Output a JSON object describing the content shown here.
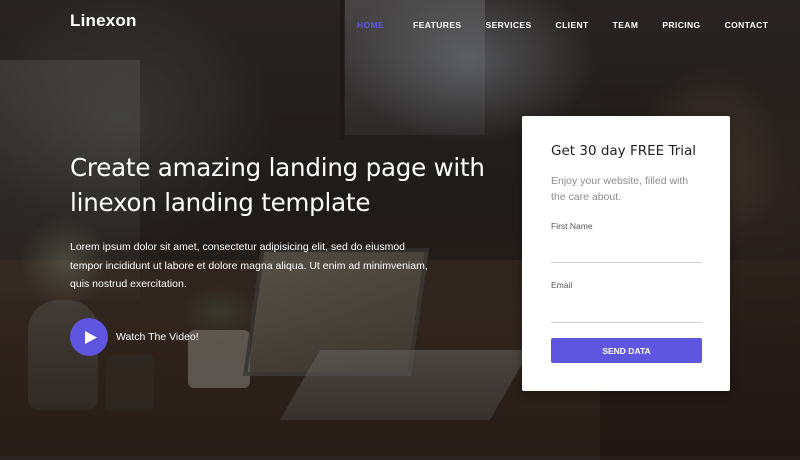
{
  "brand": {
    "name": "Linexon"
  },
  "nav": {
    "items": [
      {
        "label": "HOME",
        "active": true
      },
      {
        "label": "FEATURES",
        "active": false
      },
      {
        "label": "SERVICES",
        "active": false
      },
      {
        "label": "CLIENT",
        "active": false
      },
      {
        "label": "TEAM",
        "active": false
      },
      {
        "label": "PRICING",
        "active": false
      },
      {
        "label": "CONTACT",
        "active": false
      }
    ]
  },
  "hero": {
    "title_line1": "Create amazing landing page with",
    "title_line2": "linexon landing template",
    "desc_line1": "Lorem ipsum dolor sit amet, consectetur adipisicing elit, sed do eiusmod",
    "desc_line2": "tempor incididunt ut labore et dolore magna aliqua. Ut enim ad minimveniam,",
    "desc_line3": "quis nostrud exercitation.",
    "video_label": "Watch The Video!",
    "video_icon": "play-icon"
  },
  "trial_form": {
    "title": "Get 30 day FREE Trial",
    "subtitle_line1": "Enjoy your website, filled with",
    "subtitle_line2": "the care about.",
    "first_name_label": "First Name",
    "first_name_value": "",
    "email_label": "Email",
    "email_value": "",
    "submit_label": "SEND DATA"
  },
  "colors": {
    "accent": "#5e56e0",
    "card_bg": "#ffffff"
  }
}
